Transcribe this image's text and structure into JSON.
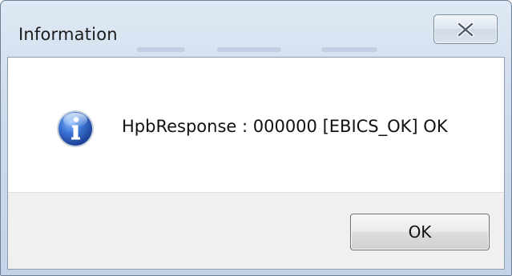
{
  "dialog": {
    "title": "Information",
    "icon": "info-icon",
    "message": "HpbResponse : 000000 [EBICS_OK] OK",
    "close_icon": "close-x-icon",
    "ok_label": "OK"
  },
  "colors": {
    "frame": "#cfdcec",
    "info_blue": "#2a5db8",
    "button_panel": "#f0f0f0"
  }
}
